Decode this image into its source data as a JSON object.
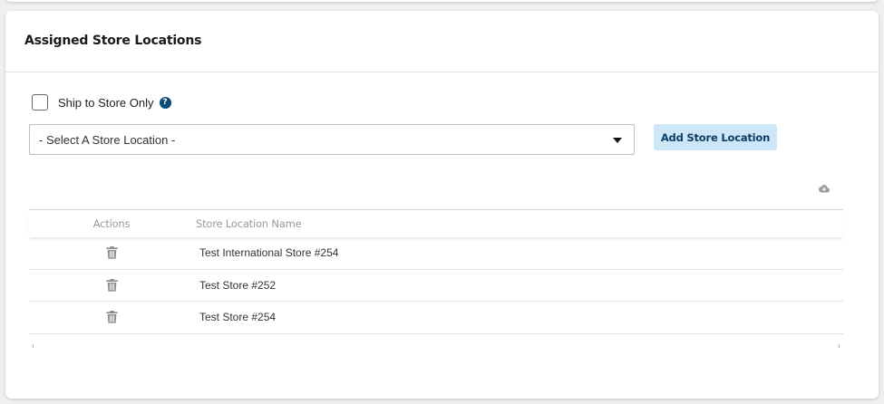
{
  "section": {
    "title": "Assigned Store Locations"
  },
  "ship_to_store": {
    "label": "Ship to Store Only",
    "checked": false,
    "help_icon": "question-circle-icon",
    "help_glyph": "?"
  },
  "store_select": {
    "selected": "- Select A Store Location -"
  },
  "add_button": {
    "label": "Add Store Location"
  },
  "toolbar": {
    "export_icon": "cloud-download-icon"
  },
  "table": {
    "columns": [
      "Actions",
      "Store Location Name"
    ],
    "rows": [
      {
        "name": "Test International Store #254",
        "action_icon": "trash-icon"
      },
      {
        "name": "Test Store #252",
        "action_icon": "trash-icon"
      },
      {
        "name": "Test Store #254",
        "action_icon": "trash-icon"
      }
    ]
  },
  "colors": {
    "accent_button_bg": "#cde6f8",
    "accent_button_text": "#0e3d66",
    "help_icon_bg": "#0c4a7a",
    "card_bg": "#ffffff",
    "page_bg": "#efefef"
  }
}
